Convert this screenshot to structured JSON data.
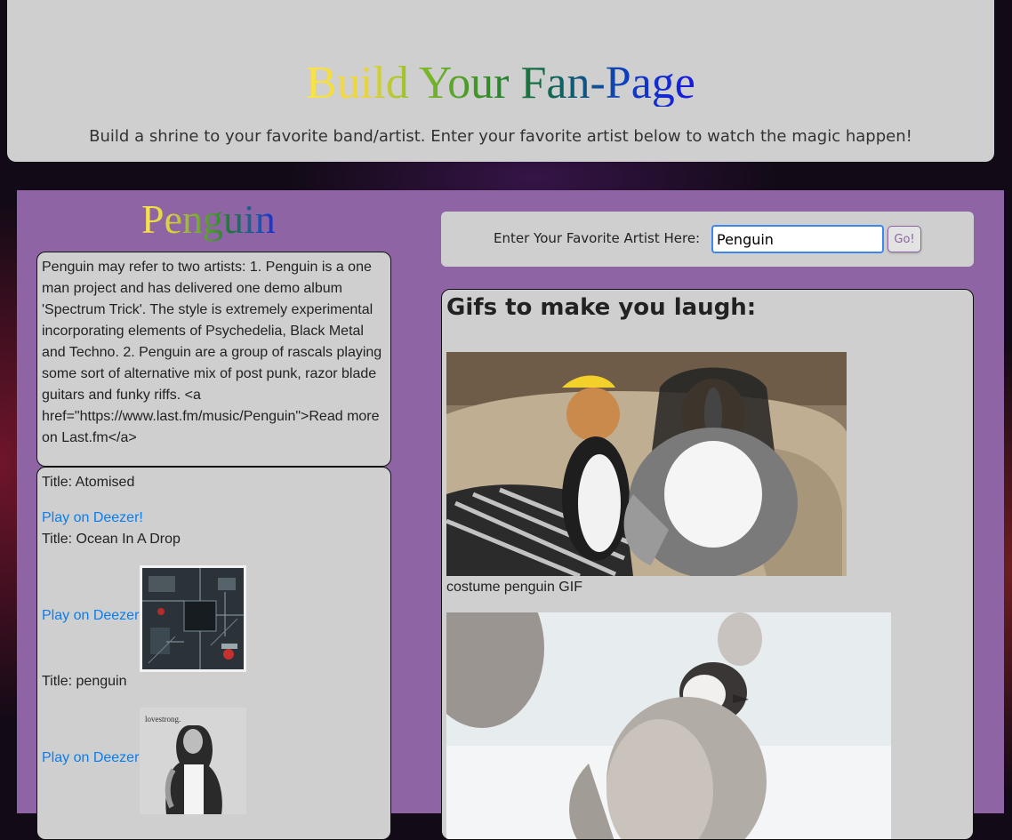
{
  "header": {
    "title": "Build Your Fan-Page",
    "subtitle": "Build a shrine to your favorite band/artist. Enter your favorite artist below to watch the magic happen!"
  },
  "artist": {
    "name": "Penguin",
    "bio": "Penguin may refer to two artists: 1. Penguin is a one man project and has delivered one demo album 'Spectrum Trick'. The style is extremely experimental incorporating elements of Psychedelia, Black Metal and Techno. 2. Penguin are a group of rascals playing some sort of alternative mix of post punk, razor blade guitars and funky riffs. <a href=\"https://www.last.fm/music/Penguin\">Read more on Last.fm</a>"
  },
  "tracks": [
    {
      "title": "Title: Atomised",
      "link_label": "Play on Deezer!"
    },
    {
      "title": "Title: Ocean In A Drop",
      "link_label": "Play on Deezer!",
      "art_icon": "circuit-board-album-art"
    },
    {
      "title": "Title: penguin",
      "link_label": "Play on Deezer!",
      "art_icon": "portrait-album-art",
      "art_text": "lovestrong."
    }
  ],
  "search": {
    "label": "Enter Your Favorite Artist Here:",
    "value": "Penguin",
    "button_label": "Go!"
  },
  "gifs": {
    "heading": "Gifs to make you laugh:",
    "items": [
      {
        "caption": "costume penguin GIF",
        "image_icon": "dogs-in-penguin-costumes-gif"
      },
      {
        "caption": "",
        "image_icon": "baby-penguin-on-snow-gif"
      }
    ]
  },
  "colors": {
    "header_bg": "#cfcfcf",
    "main_bg": "#8e64a4",
    "link": "#0a7df0",
    "input_focus": "#3b88f0"
  }
}
